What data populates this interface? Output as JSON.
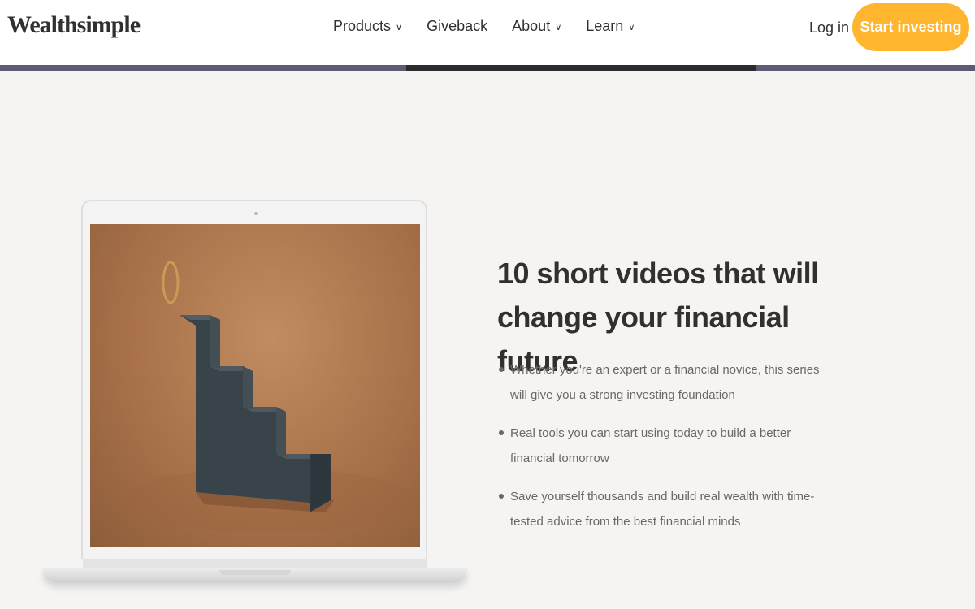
{
  "header": {
    "logo": "Wealthsimple",
    "nav": [
      {
        "label": "Products",
        "dropdown": true
      },
      {
        "label": "Giveback",
        "dropdown": false
      },
      {
        "label": "About",
        "dropdown": true
      },
      {
        "label": "Learn",
        "dropdown": true
      }
    ],
    "login_label": "Log in",
    "cta_label": "Start investing",
    "cta_color": "#ffb52e"
  },
  "hero": {
    "image": "laptop showing dark staircase sculpture with golden ring on tan background",
    "headline": "10 short videos that will change your financial future",
    "bullets": [
      "Whether you're an expert or a financial novice, this series will give you a strong investing foundation",
      "Real tools you can start using today to build a better financial tomorrow",
      "Save yourself thousands and build real wealth with time-tested advice from the best financial minds"
    ]
  },
  "icons": {
    "chevron": "chevron-down-icon",
    "bullet": "bullet-dot-icon"
  }
}
